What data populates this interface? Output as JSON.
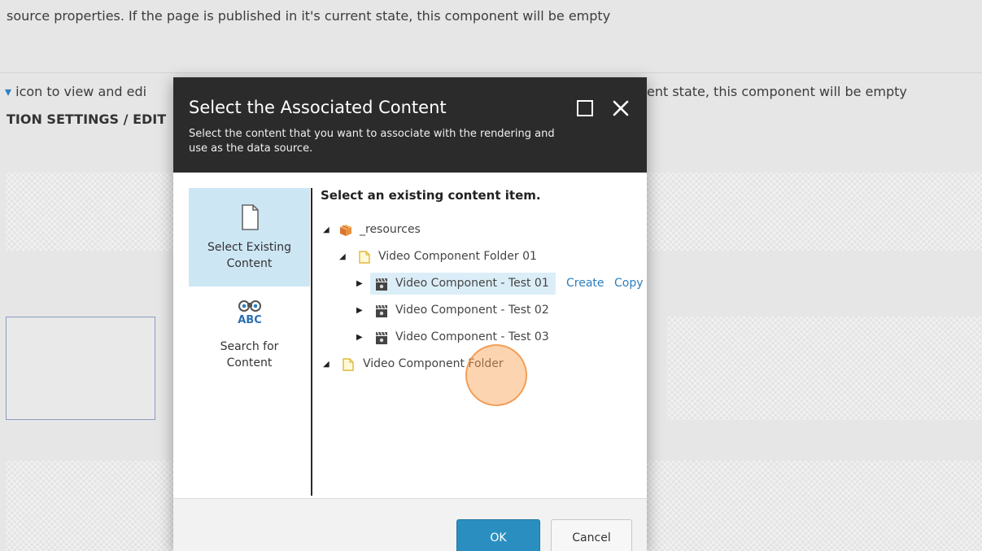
{
  "background": {
    "line1": "source properties. If the page is published in it's current state, this component will be empty",
    "line2_left": "icon to view and edi",
    "line2_right": "ent state, this component will be empty",
    "line3": "TION SETTINGS / EDIT"
  },
  "dialog": {
    "title": "Select the Associated Content",
    "subtitle": "Select the content that you want to associate with the rendering and use as the data source.",
    "maximize_icon": "maximize-icon",
    "close_icon": "close-icon",
    "nav": [
      {
        "label": "Select Existing Content",
        "icon": "document-icon",
        "active": true
      },
      {
        "label": "Search for Content",
        "icon": "binoculars-abc-icon",
        "active": false
      }
    ],
    "tree_heading": "Select an existing content item.",
    "tree": [
      {
        "label": "_resources",
        "icon": "package-icon",
        "expanded": true
      },
      {
        "label": "Video Component Folder 01",
        "icon": "folder-icon",
        "expanded": true
      },
      {
        "label": "Video Component - Test 01",
        "icon": "video-clapper-icon",
        "expanded": false,
        "selected": true
      },
      {
        "label": "Video Component - Test 02",
        "icon": "video-clapper-icon",
        "expanded": false
      },
      {
        "label": "Video Component - Test 03",
        "icon": "video-clapper-icon",
        "expanded": false
      },
      {
        "label": "Video Component Folder",
        "icon": "folder-icon",
        "expanded": true
      }
    ],
    "actions": {
      "create": "Create",
      "copy": "Copy"
    },
    "footer": {
      "ok": "OK",
      "cancel": "Cancel"
    }
  },
  "colors": {
    "header_bg": "#2b2b2b",
    "nav_active_bg": "#cde6f4",
    "selection_bg": "#dbeef8",
    "link": "#2b7fc0",
    "ok_button": "#2a8fc0",
    "cursor_highlight": "#f7a05a"
  }
}
